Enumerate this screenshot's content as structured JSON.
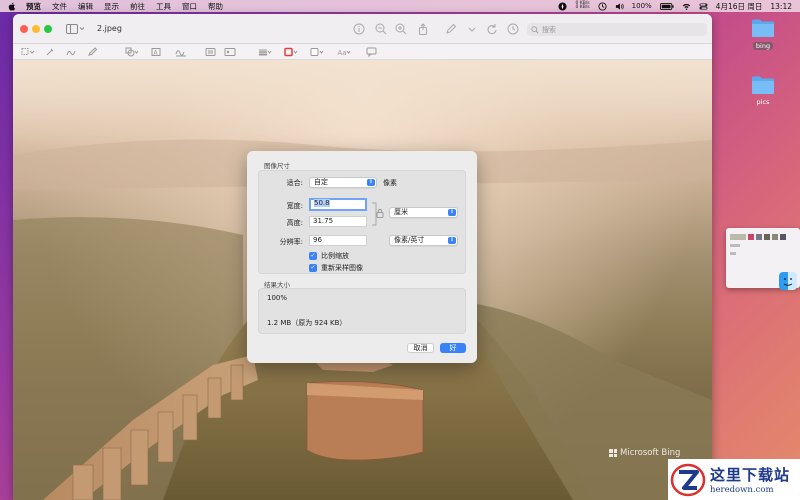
{
  "menubar": {
    "app_name": "预览",
    "items": [
      "文件",
      "编辑",
      "显示",
      "前往",
      "工具",
      "窗口",
      "帮助"
    ],
    "net_up": "0 KB/s",
    "net_down": "0 KB/s",
    "battery": "100%",
    "datetime": "4月16日 周日",
    "time": "13:12"
  },
  "window": {
    "title": "2.jpeg",
    "search_placeholder": "搜索"
  },
  "image": {
    "watermark": "Microsoft Bing"
  },
  "dialog": {
    "title": "图像尺寸",
    "fit_label": "适合:",
    "fit_value": "自定",
    "fit_unit": "像素",
    "width_label": "宽度:",
    "width_value": "50.8",
    "height_label": "高度:",
    "height_value": "31.75",
    "size_unit": "厘米",
    "resolution_label": "分辨率:",
    "resolution_value": "96",
    "resolution_unit": "像素/英寸",
    "scale_checkbox": "比例缩放",
    "resample_checkbox": "重新采样图像",
    "result_title": "结果大小",
    "result_percent": "100%",
    "result_size": "1.2 MB（原为 924 KB）",
    "cancel": "取消",
    "ok": "好"
  },
  "desktop": {
    "folders": [
      {
        "label": "bing"
      },
      {
        "label": "pics"
      }
    ]
  },
  "brand": {
    "cn": "这里下载站",
    "en": "heredown.com"
  },
  "colors": {
    "accent": "#3a82f7",
    "folder": "#5aa9ee",
    "close": "#fe5f57",
    "minimize": "#febc2e",
    "maximize": "#28c840"
  }
}
